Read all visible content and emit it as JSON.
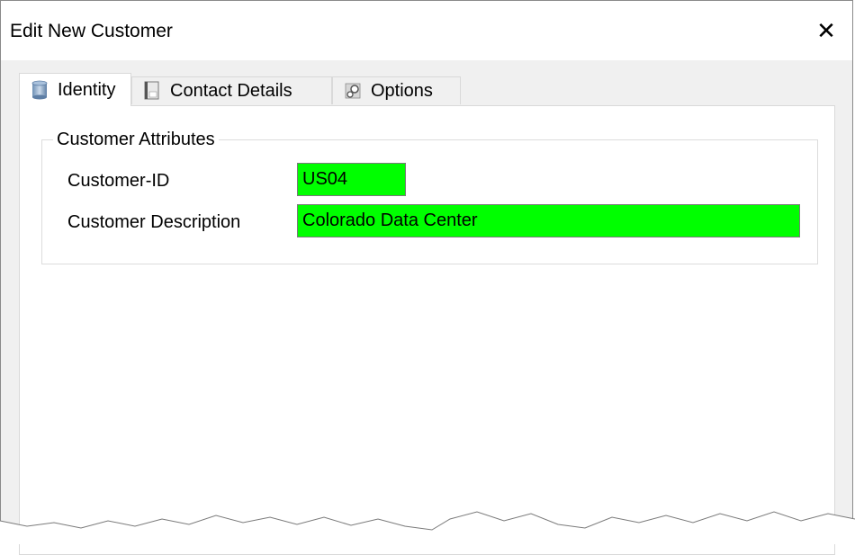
{
  "window": {
    "title": "Edit New Customer",
    "close_glyph": "✕"
  },
  "tabs": [
    {
      "label": "Identity",
      "icon": "database-icon",
      "active": true
    },
    {
      "label": "Contact Details",
      "icon": "address-book-icon",
      "active": false
    },
    {
      "label": "Options",
      "icon": "gear-icon",
      "active": false
    }
  ],
  "group": {
    "title": "Customer Attributes",
    "fields": [
      {
        "label": "Customer-ID",
        "value": "US04"
      },
      {
        "label": "Customer Description",
        "value": "Colorado Data Center"
      }
    ]
  },
  "colors": {
    "field_highlight": "#00ff00",
    "window_bg": "#f0f0f0",
    "panel_bg": "#ffffff"
  }
}
